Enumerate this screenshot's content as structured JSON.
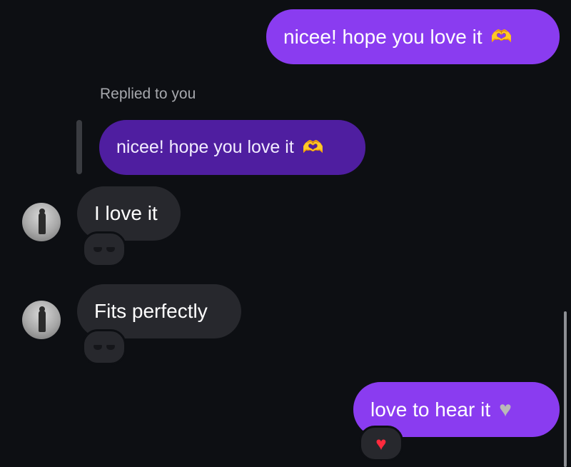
{
  "messages": {
    "first_outgoing": {
      "text": "nicee! hope you love it",
      "emoji": "heart-hands-icon"
    },
    "reply_context": {
      "label": "Replied to you",
      "quoted_text": "nicee! hope you love it"
    },
    "incoming_1": {
      "text": "I love it",
      "reaction": "sunglasses-icon"
    },
    "incoming_2": {
      "text": "Fits perfectly",
      "reaction": "sunglasses-icon"
    },
    "last_outgoing": {
      "text": "love to hear it",
      "emoji": "grey-heart-icon",
      "reaction": "red-heart-icon"
    }
  },
  "colors": {
    "background": "#0d0f13",
    "outgoing_bubble": "#8a3cf0",
    "quoted_bubble": "#4f1ea0",
    "incoming_bubble": "#27282d",
    "secondary_text": "#a6a8ad"
  }
}
